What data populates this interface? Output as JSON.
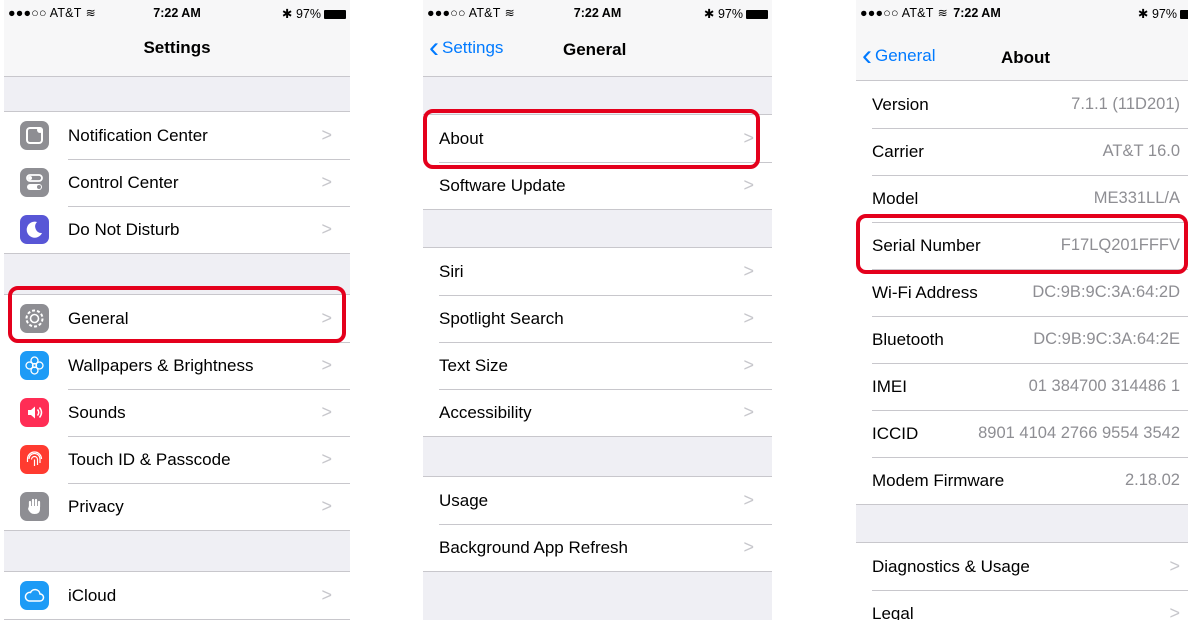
{
  "status": {
    "carrier": "●●●○○ AT&T",
    "time": "7:22 AM",
    "battery": "97%"
  },
  "colors": {
    "accent": "#007aff",
    "highlight": "#e4001c"
  },
  "settings": {
    "title": "Settings",
    "groups": [
      [
        {
          "label": "Notification Center",
          "icon": "notification-center-icon",
          "color": "#8e8e93"
        },
        {
          "label": "Control Center",
          "icon": "control-center-icon",
          "color": "#8e8e93"
        },
        {
          "label": "Do Not Disturb",
          "icon": "moon-icon",
          "color": "#5856d6"
        }
      ],
      [
        {
          "label": "General",
          "icon": "gear-icon",
          "color": "#8e8e93"
        },
        {
          "label": "Wallpapers & Brightness",
          "icon": "flower-icon",
          "color": "#1d9bf6"
        },
        {
          "label": "Sounds",
          "icon": "speaker-icon",
          "color": "#ff2d55"
        },
        {
          "label": "Touch ID & Passcode",
          "icon": "fingerprint-icon",
          "color": "#ff3b30"
        },
        {
          "label": "Privacy",
          "icon": "hand-icon",
          "color": "#8e8e93"
        }
      ],
      [
        {
          "label": "iCloud",
          "icon": "cloud-icon",
          "color": "#1d9bf6"
        }
      ]
    ]
  },
  "general": {
    "back_label": "Settings",
    "title": "General",
    "groups": [
      [
        "About",
        "Software Update"
      ],
      [
        "Siri",
        "Spotlight Search",
        "Text Size",
        "Accessibility"
      ],
      [
        "Usage",
        "Background App Refresh"
      ]
    ]
  },
  "about": {
    "back_label": "General",
    "title": "About",
    "rows": [
      {
        "label": "Version",
        "value": "7.1.1 (11D201)"
      },
      {
        "label": "Carrier",
        "value": "AT&T 16.0"
      },
      {
        "label": "Model",
        "value": "ME331LL/A"
      },
      {
        "label": "Serial Number",
        "value": "F17LQ201FFFV"
      },
      {
        "label": "Wi-Fi Address",
        "value": "DC:9B:9C:3A:64:2D"
      },
      {
        "label": "Bluetooth",
        "value": "DC:9B:9C:3A:64:2E"
      },
      {
        "label": "IMEI",
        "value": "01 384700 314486 1"
      },
      {
        "label": "ICCID",
        "value": "8901 4104 2766 9554 3542"
      },
      {
        "label": "Modem Firmware",
        "value": "2.18.02"
      }
    ],
    "links": [
      "Diagnostics & Usage",
      "Legal"
    ]
  }
}
